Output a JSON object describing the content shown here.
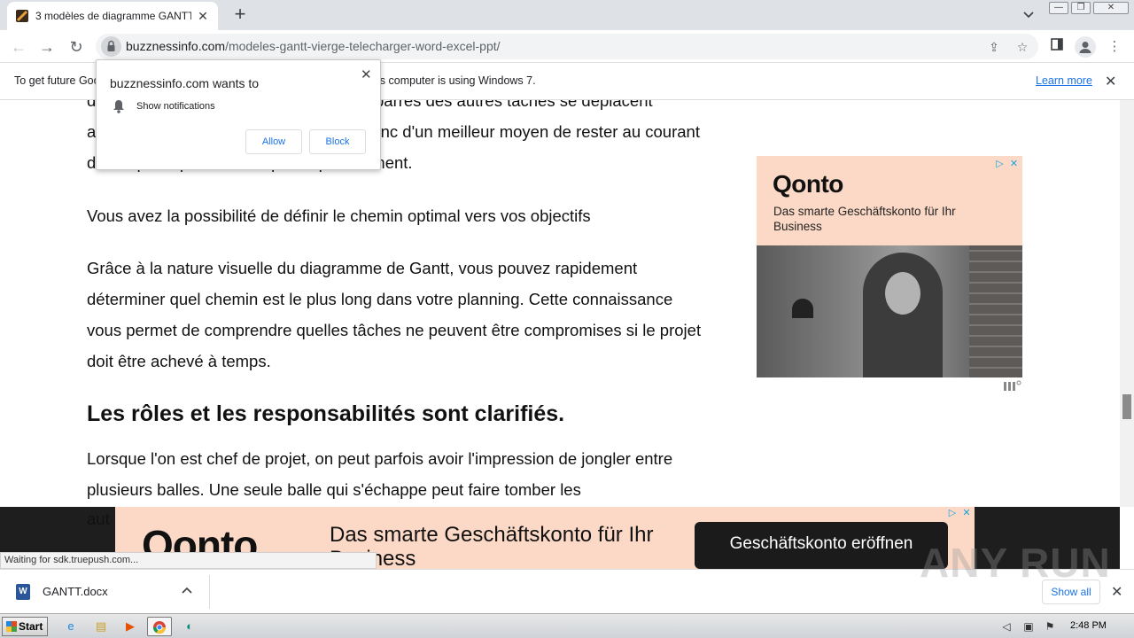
{
  "browser": {
    "tab_title": "3 modèles de diagramme GANTT vierge",
    "url_domain": "buzznessinfo.com",
    "url_path": "/modeles-gantt-vierge-telecharger-word-excel-ppt/"
  },
  "infobar": {
    "text": "To get future Google Chrome updates, you'll need Windows 10 or later. This computer is using Windows 7.",
    "learn_more": "Learn more"
  },
  "notification": {
    "title": "buzznessinfo.com wants to",
    "permission": "Show notifications",
    "allow": "Allow",
    "block": "Block"
  },
  "article": {
    "p0": "durée de certaines tâches pour que les barres des autres tâches se déplacent automatiquement en fonction. Il s'agit donc d'un meilleur moyen de rester au courant de ce qui se passe à n'importe quel moment.",
    "p1": "Vous avez la possibilité de définir le chemin optimal vers vos objectifs",
    "p2": "Grâce à la nature visuelle du diagramme de Gantt, vous pouvez rapidement déterminer quel chemin est le plus long dans votre planning. Cette connaissance vous permet de comprendre quelles tâches ne peuvent être compromises si le projet doit être achevé à temps.",
    "h2": "Les rôles et les responsabilités sont clarifiés.",
    "p3": "Lorsque l'on est chef de projet, on peut parfois avoir l'impression de jongler entre plusieurs balles. Une seule balle qui s'échappe peut faire tomber les",
    "p3_tail": "aut"
  },
  "side_ad": {
    "logo": "Qonto",
    "text": "Das smarte Geschäftskonto für Ihr Business"
  },
  "banner_ad": {
    "logo": "Qonto",
    "text": "Das smarte Geschäftskonto für Ihr Business",
    "cta": "Geschäftskonto eröffnen"
  },
  "status_text": "Waiting for sdk.truepush.com...",
  "download": {
    "file": "GANTT.docx",
    "show_all": "Show all"
  },
  "taskbar": {
    "start": "Start",
    "clock": "2:48 PM"
  },
  "watermark": "ANY RUN",
  "colors": {
    "ad_bg": "#fcd9c6",
    "link": "#1a73e8"
  }
}
